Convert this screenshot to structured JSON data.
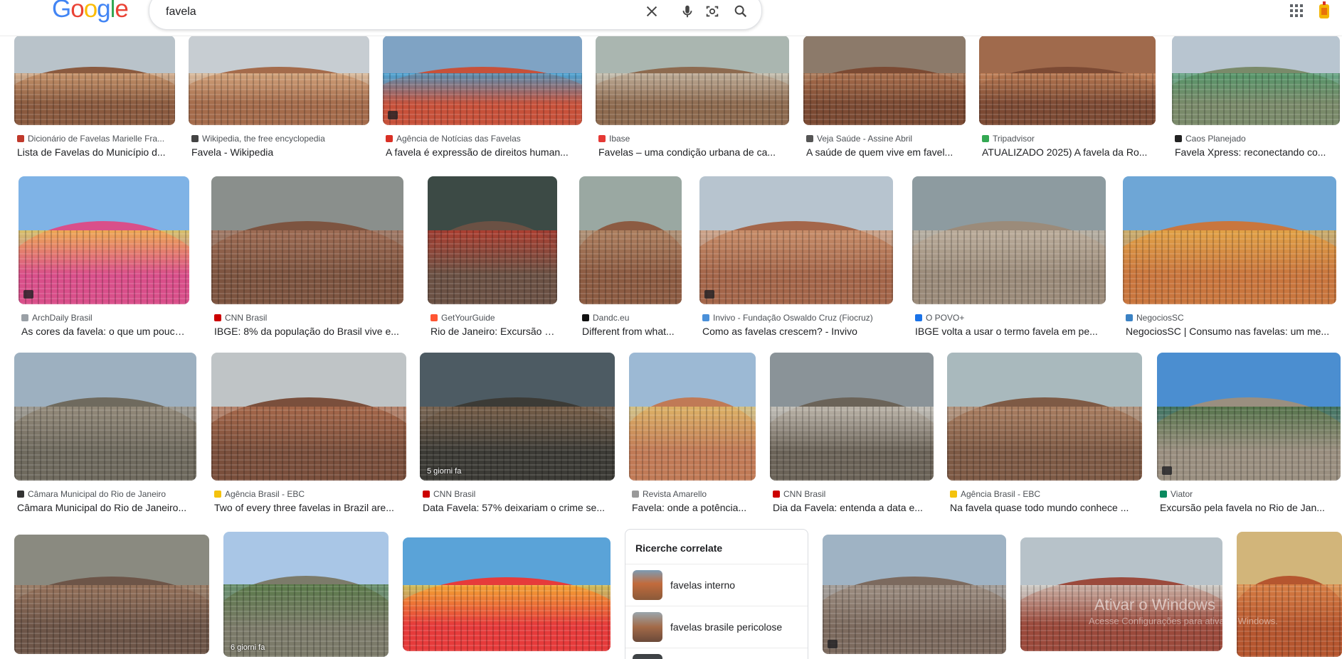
{
  "search": {
    "query": "favela"
  },
  "logo": {
    "text": "Google"
  },
  "icons": {
    "clear": "close-icon",
    "voice": "microphone-icon",
    "lens": "camera-lens-icon",
    "search": "search-icon",
    "apps": "apps-grid-icon",
    "account": "avatar"
  },
  "results": [
    {
      "source": "Dicionário de Favelas Marielle Fra...",
      "title": "Lista de Favelas do Município d...",
      "fav": "#c0392b"
    },
    {
      "source": "Wikipedia, the free encyclopedia",
      "title": "Favela - Wikipedia",
      "fav": "#444444"
    },
    {
      "source": "Agência de Notícias das Favelas",
      "title": "A favela é expressão de direitos human...",
      "fav": "#d93025"
    },
    {
      "source": "Ibase",
      "title": "Favelas – uma condição urbana de ca...",
      "fav": "#e53935"
    },
    {
      "source": "Veja Saúde - Assine Abril",
      "title": "A saúde de quem vive em favel...",
      "fav": "#555555"
    },
    {
      "source": "Tripadvisor",
      "title": "ATUALIZADO 2025) A favela da Ro...",
      "fav": "#34a853"
    },
    {
      "source": "Caos Planejado",
      "title": "Favela Xpress: reconectando co...",
      "fav": "#222222"
    },
    {
      "source": "ArchDaily Brasil",
      "title": "As cores da favela: o que um pouco...",
      "fav": "#9aa0a6"
    },
    {
      "source": "CNN Brasil",
      "title": "IBGE: 8% da população do Brasil vive e...",
      "fav": "#cc0000"
    },
    {
      "source": "GetYourGuide",
      "title": "Rio de Janeiro: Excursão a ...",
      "fav": "#ff5533"
    },
    {
      "source": "Dandc.eu",
      "title": "Different from what...",
      "fav": "#111111"
    },
    {
      "source": "Invivo - Fundação Oswaldo Cruz (Fiocruz)",
      "title": "Como as favelas crescem? - Invivo",
      "fav": "#4a90d9"
    },
    {
      "source": "O POVO+",
      "title": "IBGE volta a usar o termo favela em pe...",
      "fav": "#1a73e8"
    },
    {
      "source": "NegociosSC",
      "title": "NegociosSC | Consumo nas favelas: um me...",
      "fav": "#3b82c4"
    },
    {
      "source": "Câmara Municipal do Rio de Janeiro",
      "title": "Câmara Municipal do Rio de Janeiro...",
      "fav": "#333333"
    },
    {
      "source": "Agência Brasil - EBC",
      "title": "Two of every three favelas in Brazil are...",
      "fav": "#f4c20d"
    },
    {
      "source": "CNN Brasil",
      "title": "Data Favela: 57% deixariam o crime se...",
      "fav": "#cc0000"
    },
    {
      "source": "Revista Amarello",
      "title": "Favela: onde a potência...",
      "fav": "#999999"
    },
    {
      "source": "CNN Brasil",
      "title": "Dia da Favela: entenda a data e...",
      "fav": "#cc0000"
    },
    {
      "source": "Agência Brasil - EBC",
      "title": "Na favela quase todo mundo conhece ...",
      "fav": "#f4c20d"
    },
    {
      "source": "Viator",
      "title": "Excursão pela favela no Rio de Jan...",
      "fav": "#0a8a5f"
    }
  ],
  "age_tags": {
    "r3c3": "5 giorni fa",
    "r4c2": "6 giorni fa"
  },
  "related": {
    "heading": "Ricerche correlate",
    "items": [
      "favelas interno",
      "favelas brasile pericolose"
    ]
  },
  "watermark": {
    "line1": "Ativar o Windows",
    "line2": "Acesse Configurações para ativar o Windows."
  }
}
